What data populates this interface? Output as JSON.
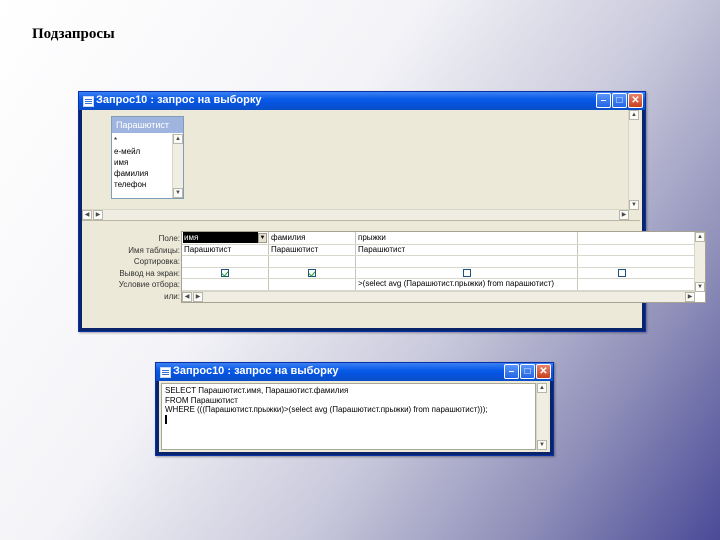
{
  "slide": {
    "title": "Подзапросы"
  },
  "query_window": {
    "title": "Запрос10 : запрос на выборку",
    "table": {
      "name": "Парашютист",
      "fields": [
        "*",
        "e-мейл",
        "имя",
        "фамилия",
        "телефон"
      ]
    },
    "grid": {
      "row_labels": [
        "Поле:",
        "Имя таблицы:",
        "Сортировка:",
        "Вывод на экран:",
        "Условие отбора:",
        "или:"
      ],
      "columns": [
        {
          "field": "имя",
          "table": "Парашютист",
          "show": true,
          "criteria": ""
        },
        {
          "field": "фамилия",
          "table": "Парашютист",
          "show": true,
          "criteria": ""
        },
        {
          "field": "прыжки",
          "table": "Парашютист",
          "show": false,
          "criteria": ">(select avg (Парашютист.прыжки) from парашютист)"
        },
        {
          "field": "",
          "table": "",
          "show": false,
          "criteria": ""
        }
      ]
    }
  },
  "sql_window": {
    "title": "Запрос10 : запрос на выборку",
    "lines": [
      "SELECT Парашютист.имя, Парашютист.фамилия",
      "FROM Парашютист",
      "WHERE (((Парашютист.прыжки)>(select avg (Парашютист.прыжки) from парашютист)));"
    ]
  },
  "colors": {
    "titlebar": "#0553e1",
    "close_button": "#c9401e",
    "window_face": "#ece9d8",
    "background_accent": "#4a4a98"
  },
  "icons": [
    "window-icon",
    "minimize-icon",
    "maximize-icon",
    "close-icon",
    "scroll-up-icon",
    "scroll-down-icon",
    "scroll-left-icon",
    "scroll-right-icon",
    "dropdown-arrow-icon",
    "checkbox-icon"
  ]
}
